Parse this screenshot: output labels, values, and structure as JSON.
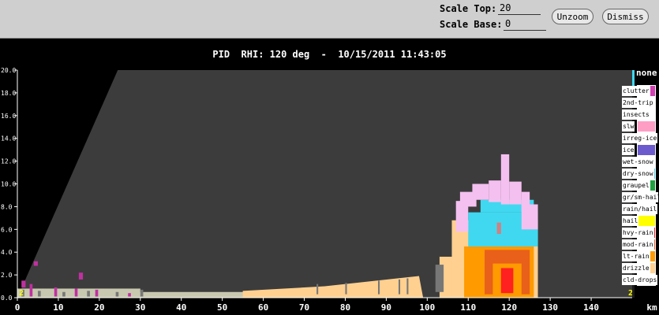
{
  "toolbar": {
    "scale_top_label": "Scale Top:",
    "scale_top_value": "20",
    "scale_base_label": "Scale Base:",
    "scale_base_value": "0",
    "unzoom_label": "Unzoom",
    "dismiss_label": "Dismiss"
  },
  "title": "PID  RHI: 120 deg  -  10/15/2011 11:43:05",
  "legend": {
    "none_label": "none",
    "items": [
      {
        "label": "clutter",
        "color": "#d040b0"
      },
      {
        "label": "2nd-trip",
        "color": "#ffffff"
      },
      {
        "label": "insects",
        "color": "#ffffff"
      },
      {
        "label": "slw",
        "color": "#ff9ec4"
      },
      {
        "label": "irreg-ice",
        "color": "#ffffff"
      },
      {
        "label": "ice",
        "color": "#6a5acd"
      },
      {
        "label": "wet-snow",
        "color": "#ffffff"
      },
      {
        "label": "dry-snow",
        "color": "#40d8f0"
      },
      {
        "label": "graupel",
        "color": "#20a040"
      },
      {
        "label": "gr/sm-hail",
        "color": "#30b030"
      },
      {
        "label": "rain/hail",
        "color": "#40c020"
      },
      {
        "label": "hail",
        "color": "#ffff00"
      },
      {
        "label": "hvy-rain",
        "color": "#ff2020"
      },
      {
        "label": "mod-rain",
        "color": "#ff5a1f"
      },
      {
        "label": "lt-rain",
        "color": "#ff9a00"
      },
      {
        "label": "drizzle",
        "color": "#ffd090"
      },
      {
        "label": "cld-drops",
        "color": "#ffffff"
      }
    ]
  },
  "chart_data": {
    "type": "heatmap",
    "title": "PID  RHI: 120 deg  -  10/15/2011 11:43:05",
    "xlabel": "km",
    "ylabel": "",
    "xlim": [
      0,
      150
    ],
    "ylim": [
      0,
      20
    ],
    "x_ticks": [
      "0",
      "10",
      "20",
      "30",
      "40",
      "50",
      "60",
      "70",
      "80",
      "90",
      "100",
      "110",
      "120",
      "130",
      "140"
    ],
    "y_ticks": [
      "0.0",
      "2.0",
      "4.0",
      "6.0",
      "8.0",
      "10.0",
      "12.0",
      "14.0",
      "16.0",
      "18.0",
      "20.0"
    ],
    "corner_labels": [
      "2",
      "2"
    ],
    "colors": {
      "background": "#000000",
      "radar_coverage": "#3c3c3c",
      "drizzle": "#ffd090",
      "lt_rain": "#ff9a00",
      "mod_rain": "#e8601a",
      "hvy_rain": "#ff2020",
      "dry_snow": "#40d8f0",
      "slw": "#f4c0f0",
      "clutter": "#c030a0",
      "ground": "#c8c8b0"
    },
    "regions": [
      {
        "class": "ground clutter",
        "x": [
          0,
          60
        ],
        "y": [
          0,
          0.7
        ]
      },
      {
        "class": "drizzle",
        "x": [
          55,
          100
        ],
        "y": [
          0,
          2.0
        ]
      },
      {
        "class": "drizzle",
        "x": [
          103,
          127
        ],
        "y": [
          0,
          7.0
        ]
      },
      {
        "class": "lt-rain",
        "x": [
          108,
          126
        ],
        "y": [
          0,
          4.6
        ]
      },
      {
        "class": "hvy-rain",
        "x": [
          117,
          122
        ],
        "y": [
          0.5,
          2.8
        ]
      },
      {
        "class": "dry-snow",
        "x": [
          110,
          127
        ],
        "y": [
          4.0,
          8.8
        ]
      },
      {
        "class": "slw",
        "x": [
          106,
          127
        ],
        "y": [
          6.5,
          12.5
        ]
      }
    ]
  }
}
